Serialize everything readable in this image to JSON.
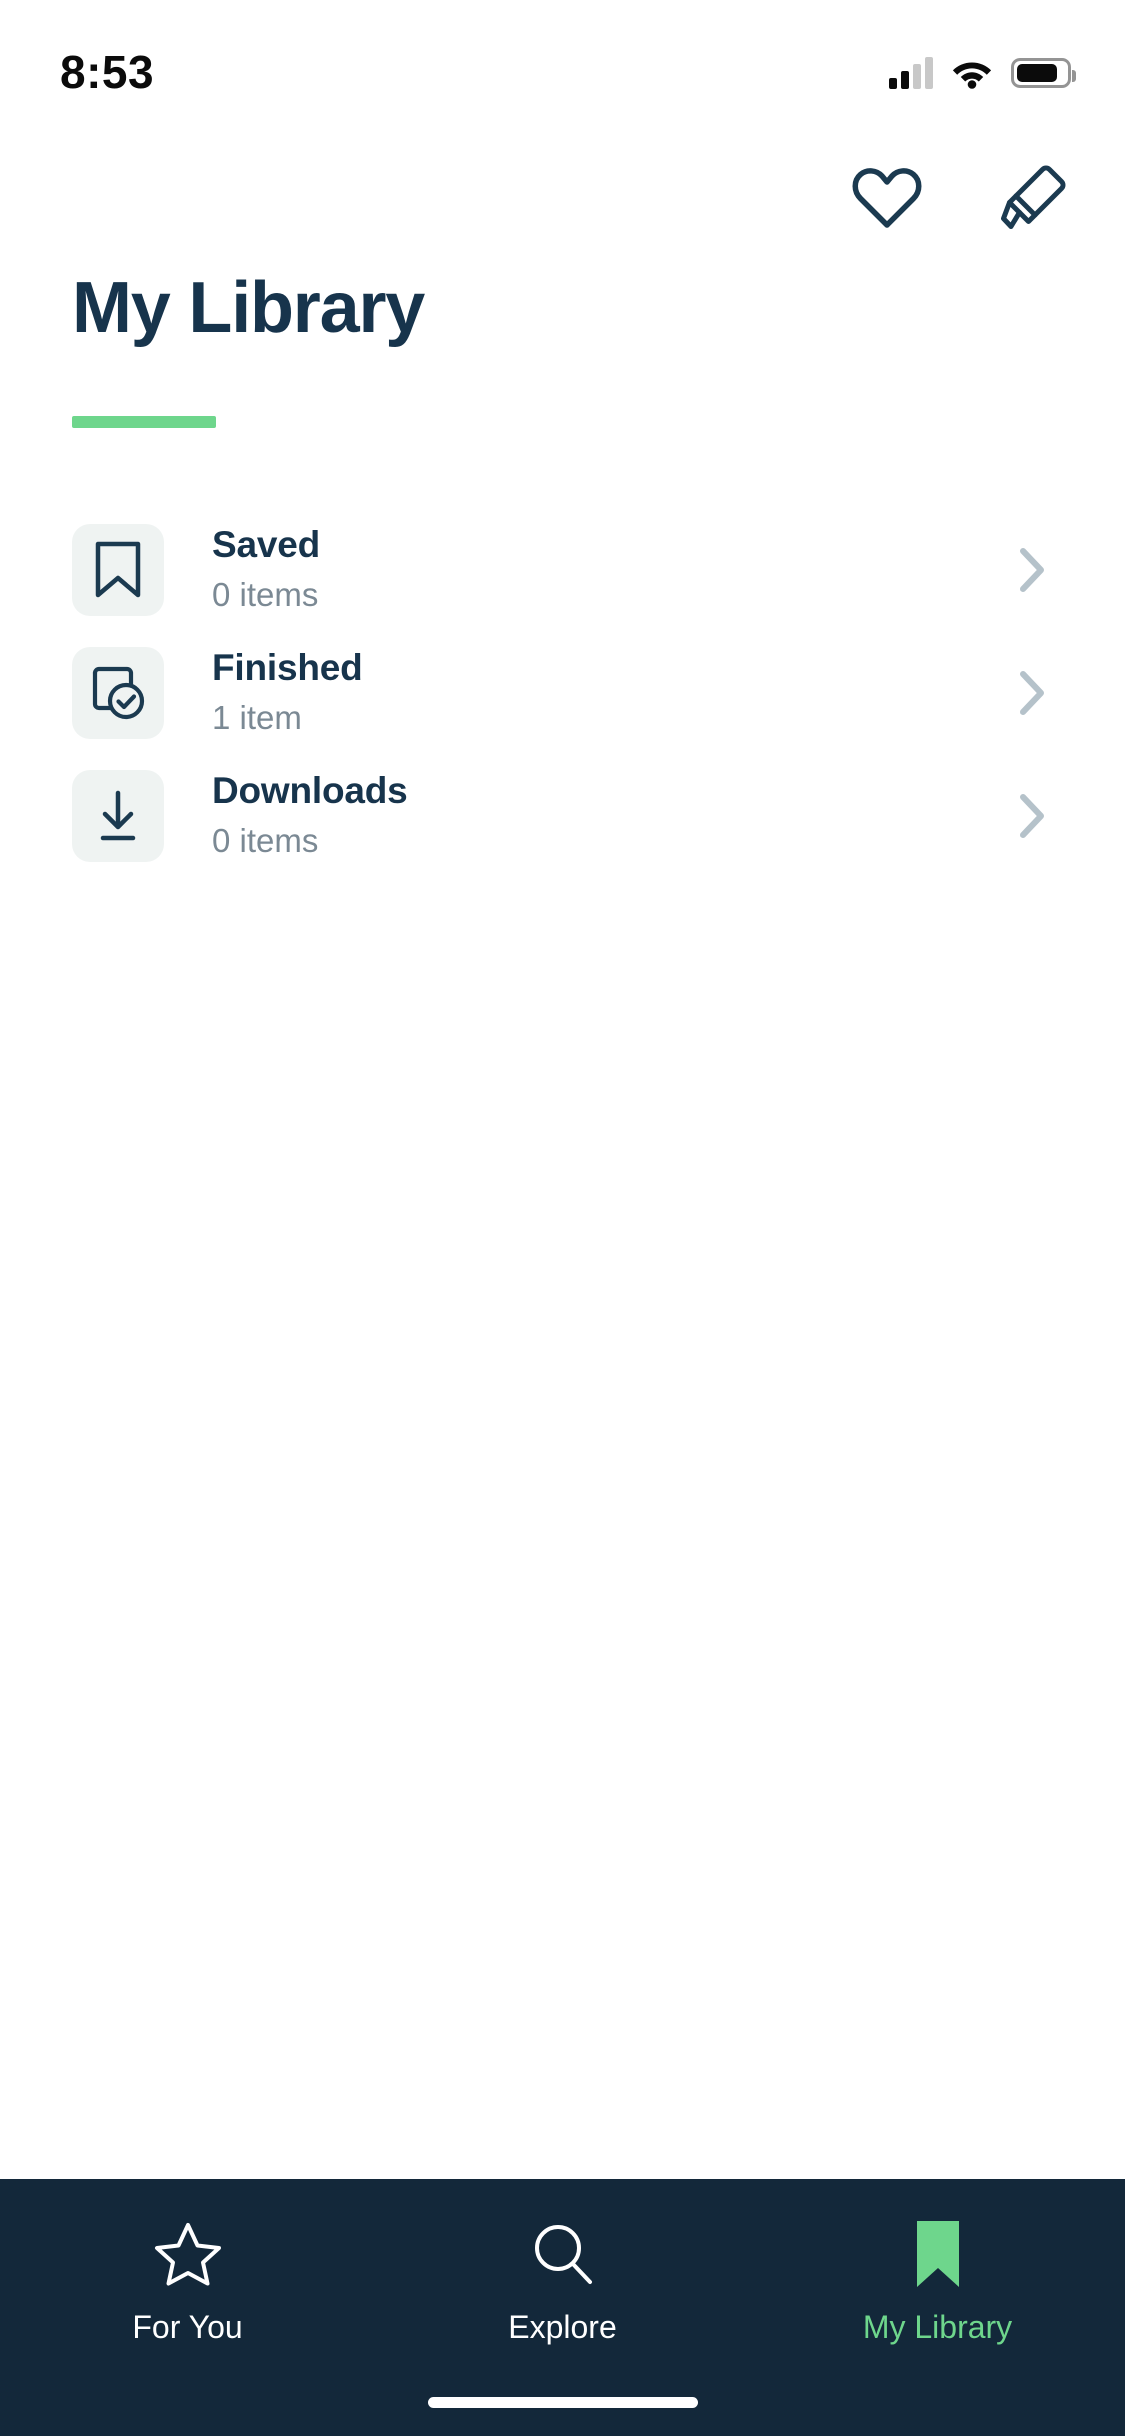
{
  "status_bar": {
    "time": "8:53",
    "cell_icon": "cellular-signal-icon",
    "wifi_icon": "wifi-icon",
    "battery_icon": "battery-icon"
  },
  "header": {
    "favorites_icon": "heart-icon",
    "highlights_icon": "highlighter-icon"
  },
  "page": {
    "title": "My Library",
    "accent_color": "#6ED68C",
    "text_color": "#17344C",
    "muted_color": "#7B8994",
    "tile_color": "#EFF3F2",
    "chevron_color": "#B5C2CA"
  },
  "library_items": [
    {
      "label": "Saved",
      "count": "0 items",
      "icon": "bookmark-icon",
      "chevron": "chevron-right-icon"
    },
    {
      "label": "Finished",
      "count": "1 item",
      "icon": "document-check-icon",
      "chevron": "chevron-right-icon"
    },
    {
      "label": "Downloads",
      "count": "0 items",
      "icon": "download-icon",
      "chevron": "chevron-right-icon"
    }
  ],
  "tab_bar": {
    "background": "#13283A",
    "active_color": "#6ED68C",
    "inactive_color": "#FFFFFF",
    "tabs": [
      {
        "label": "For You",
        "icon": "star-icon",
        "active": false
      },
      {
        "label": "Explore",
        "icon": "search-icon",
        "active": false
      },
      {
        "label": "My Library",
        "icon": "bookmark-filled-icon",
        "active": true
      }
    ]
  }
}
